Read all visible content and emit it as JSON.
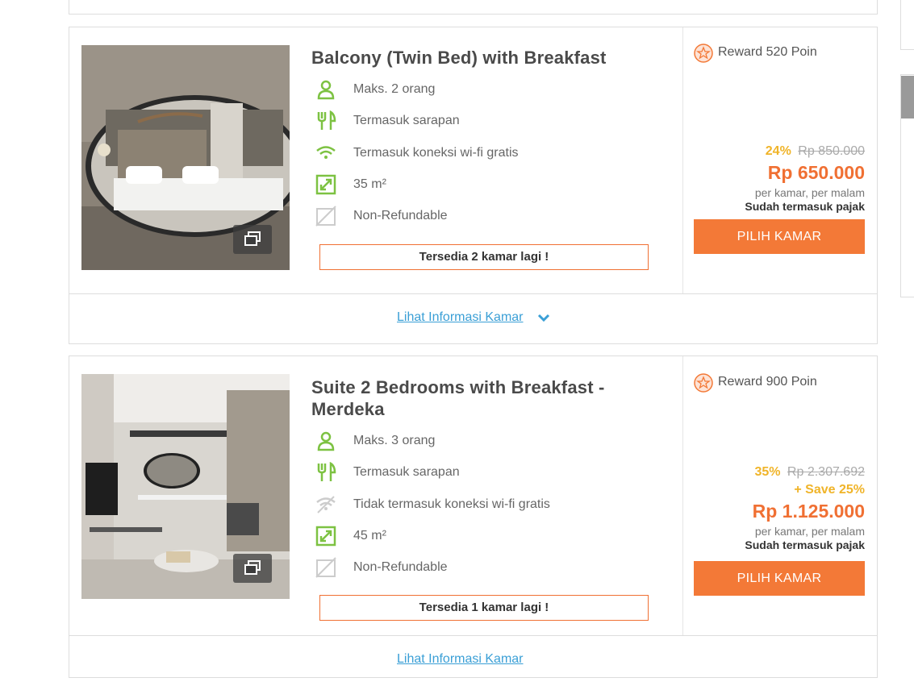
{
  "rooms": [
    {
      "title": "Balcony (Twin Bed) with Breakfast",
      "features": [
        {
          "icon": "person-icon",
          "text": "Maks. 2 orang"
        },
        {
          "icon": "cutlery-icon",
          "text": "Termasuk sarapan"
        },
        {
          "icon": "wifi-icon",
          "text": "Termasuk koneksi wi-fi gratis"
        },
        {
          "icon": "expand-icon",
          "text": "35 m²"
        },
        {
          "icon": "non-refundable-icon",
          "text": "Non-Refundable"
        }
      ],
      "availability": "Tersedia 2 kamar lagi !",
      "reward": "Reward 520 Poin",
      "discount_pct": "24%",
      "original_price": "Rp 850.000",
      "save": "",
      "price": "Rp 650.000",
      "per_unit": "per kamar, per malam",
      "tax_note": "Sudah termasuk pajak",
      "button": "PILIH KAMAR",
      "info_link": "Lihat Informasi Kamar"
    },
    {
      "title": "Suite 2 Bedrooms with Breakfast - Merdeka",
      "features": [
        {
          "icon": "person-icon",
          "text": "Maks. 3 orang"
        },
        {
          "icon": "cutlery-icon",
          "text": "Termasuk sarapan"
        },
        {
          "icon": "no-wifi-icon",
          "text": "Tidak termasuk koneksi wi-fi gratis"
        },
        {
          "icon": "expand-icon",
          "text": "45 m²"
        },
        {
          "icon": "non-refundable-icon",
          "text": "Non-Refundable"
        }
      ],
      "availability": "Tersedia 1 kamar lagi !",
      "reward": "Reward 900 Poin",
      "discount_pct": "35%",
      "original_price": "Rp 2.307.692",
      "save": "+ Save 25%",
      "price": "Rp 1.125.000",
      "per_unit": "per kamar, per malam",
      "tax_note": "Sudah termasuk pajak",
      "button": "PILIH KAMAR",
      "info_link": "Lihat Informasi Kamar"
    }
  ],
  "colors": {
    "accent": "#f37937",
    "discount": "#f0b429",
    "icon_green": "#7dc242",
    "link": "#3a9fd6"
  }
}
